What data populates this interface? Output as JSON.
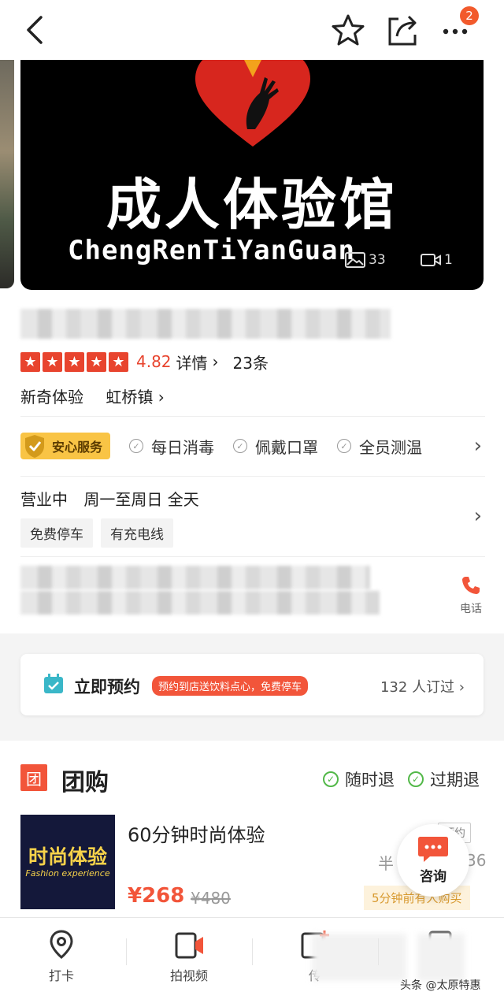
{
  "header": {
    "notification_count": "2",
    "icons": [
      "back-icon",
      "star-icon",
      "share-icon",
      "more-icon"
    ]
  },
  "banner": {
    "title": "成人体验馆",
    "subtitle": "ChengRenTiYanGuan",
    "photo_count": "33",
    "video_count": "1"
  },
  "store": {
    "rating": "4.82",
    "detail_label": "详情",
    "review_count": "23条",
    "category": "新奇体验",
    "area": "虹桥镇"
  },
  "safety": {
    "badge": "安心服务",
    "items": [
      "每日消毒",
      "佩戴口罩",
      "全员测温"
    ]
  },
  "hours": {
    "status": "营业中",
    "days": "周一至周日 全天"
  },
  "facilities": [
    "免费停车",
    "有充电线"
  ],
  "contact": {
    "phone_label": "电话"
  },
  "booking": {
    "label": "立即预约",
    "promo": "预约到店送饮料点心，免费停车",
    "booked": "132 人订过"
  },
  "group_buy": {
    "title": "团购",
    "icon_text": "团",
    "refund_anytime": "随时退",
    "refund_expired": "过期退",
    "deal": {
      "image_title": "时尚体验",
      "image_sub": "Fashion experience",
      "name": "60分钟时尚体验",
      "price": "¥268",
      "original_price": "¥480",
      "reserve_tag": "预约",
      "half_label": "半",
      "half_num": "36",
      "recent_purchase": "5分钟前有人购买"
    }
  },
  "consult": {
    "label": "咨询"
  },
  "bottom_tabs": [
    "打卡",
    "拍视频",
    "传"
  ],
  "watermark": "头条 @太原特惠",
  "colors": {
    "accent": "#f2553a",
    "rating_red": "#e8442e",
    "safe_badge": "#f9c445",
    "check_green": "#52b848"
  }
}
